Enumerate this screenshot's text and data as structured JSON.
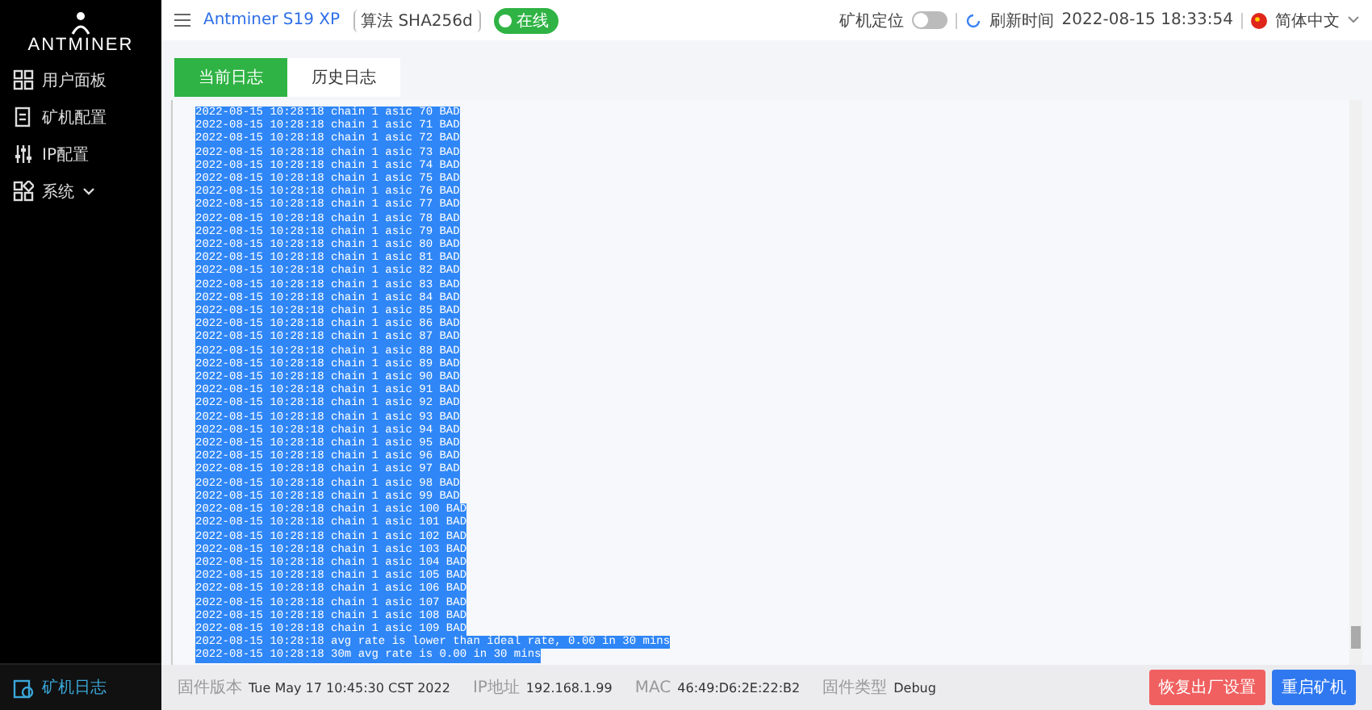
{
  "sidebar": {
    "logo": "ANTMINER",
    "items": [
      {
        "label": "用户面板",
        "kind": "link",
        "selected": false
      },
      {
        "label": "矿机配置",
        "kind": "link",
        "selected": false
      },
      {
        "label": "IP配置",
        "kind": "link",
        "selected": false
      },
      {
        "label": "系统",
        "kind": "group",
        "selected": false
      }
    ],
    "bottom_item": {
      "label": "矿机日志",
      "selected": true
    }
  },
  "header": {
    "model": "Antminer S19 XP",
    "algorithm": "算法 SHA256d",
    "status": {
      "label": "在线",
      "color": "#2fb344"
    },
    "locate": {
      "label": "矿机定位",
      "on": false
    },
    "refresh_label": "刷新时间",
    "refresh_time": "2022-08-15 18:33:54",
    "language": "简体中文"
  },
  "tabs": [
    {
      "label": "当前日志",
      "selected": true
    },
    {
      "label": "历史日志",
      "selected": false
    }
  ],
  "log": {
    "selected": true,
    "lines": [
      "2022-08-15 10:28:18 chain 1 asic 70 BAD",
      "2022-08-15 10:28:18 chain 1 asic 71 BAD",
      "2022-08-15 10:28:18 chain 1 asic 72 BAD",
      "2022-08-15 10:28:18 chain 1 asic 73 BAD",
      "2022-08-15 10:28:18 chain 1 asic 74 BAD",
      "2022-08-15 10:28:18 chain 1 asic 75 BAD",
      "2022-08-15 10:28:18 chain 1 asic 76 BAD",
      "2022-08-15 10:28:18 chain 1 asic 77 BAD",
      "2022-08-15 10:28:18 chain 1 asic 78 BAD",
      "2022-08-15 10:28:18 chain 1 asic 79 BAD",
      "2022-08-15 10:28:18 chain 1 asic 80 BAD",
      "2022-08-15 10:28:18 chain 1 asic 81 BAD",
      "2022-08-15 10:28:18 chain 1 asic 82 BAD",
      "2022-08-15 10:28:18 chain 1 asic 83 BAD",
      "2022-08-15 10:28:18 chain 1 asic 84 BAD",
      "2022-08-15 10:28:18 chain 1 asic 85 BAD",
      "2022-08-15 10:28:18 chain 1 asic 86 BAD",
      "2022-08-15 10:28:18 chain 1 asic 87 BAD",
      "2022-08-15 10:28:18 chain 1 asic 88 BAD",
      "2022-08-15 10:28:18 chain 1 asic 89 BAD",
      "2022-08-15 10:28:18 chain 1 asic 90 BAD",
      "2022-08-15 10:28:18 chain 1 asic 91 BAD",
      "2022-08-15 10:28:18 chain 1 asic 92 BAD",
      "2022-08-15 10:28:18 chain 1 asic 93 BAD",
      "2022-08-15 10:28:18 chain 1 asic 94 BAD",
      "2022-08-15 10:28:18 chain 1 asic 95 BAD",
      "2022-08-15 10:28:18 chain 1 asic 96 BAD",
      "2022-08-15 10:28:18 chain 1 asic 97 BAD",
      "2022-08-15 10:28:18 chain 1 asic 98 BAD",
      "2022-08-15 10:28:18 chain 1 asic 99 BAD",
      "2022-08-15 10:28:18 chain 1 asic 100 BAD",
      "2022-08-15 10:28:18 chain 1 asic 101 BAD",
      "2022-08-15 10:28:18 chain 1 asic 102 BAD",
      "2022-08-15 10:28:18 chain 1 asic 103 BAD",
      "2022-08-15 10:28:18 chain 1 asic 104 BAD",
      "2022-08-15 10:28:18 chain 1 asic 105 BAD",
      "2022-08-15 10:28:18 chain 1 asic 106 BAD",
      "2022-08-15 10:28:18 chain 1 asic 107 BAD",
      "2022-08-15 10:28:18 chain 1 asic 108 BAD",
      "2022-08-15 10:28:18 chain 1 asic 109 BAD",
      "2022-08-15 10:28:18 avg rate is lower than ideal rate, 0.00 in 30 mins",
      "2022-08-15 10:28:18 30m avg rate is 0.00 in 30 mins"
    ]
  },
  "footer": {
    "info": [
      {
        "label": "固件版本",
        "value": "Tue May 17 10:45:30 CST 2022"
      },
      {
        "label": "IP地址",
        "value": "192.168.1.99"
      },
      {
        "label": "MAC",
        "value": "46:49:D6:2E:22:B2"
      },
      {
        "label": "固件类型",
        "value": "Debug"
      }
    ],
    "buttons": [
      {
        "label": "恢复出厂设置",
        "kind": "danger"
      },
      {
        "label": "重启矿机",
        "kind": "primary"
      }
    ]
  }
}
